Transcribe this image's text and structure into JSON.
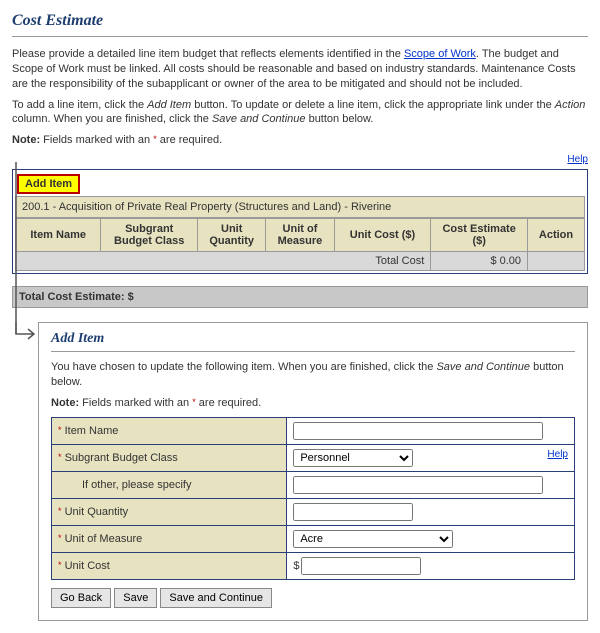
{
  "title": "Cost Estimate",
  "intro": {
    "p1a": "Please provide a detailed line item budget that reflects elements identified in the ",
    "scope_link": "Scope of Work",
    "p1b": ". The budget and Scope of Work must be linked. All costs should be reasonable and based on industry standards. Maintenance Costs are the responsibility of the subapplicant or owner of the area to be mitigated and should not be included.",
    "p2a": "To add a line item, click the ",
    "p2b": " button. To update or delete a line item, click the appropriate link under the ",
    "p2c": " column. When you are finished, click the ",
    "p2d": " button below.",
    "add_item_em": "Add Item",
    "action_em": "Action",
    "save_cont_em": "Save and Continue",
    "note_label": "Note:",
    "note_text": "  Fields marked with an ",
    "note_text2": " are required.",
    "asterisk": "*"
  },
  "help": "Help",
  "add_item_btn": "Add Item",
  "section_header": "200.1 - Acquisition of Private Real Property (Structures and Land) - Riverine",
  "columns": {
    "item_name": "Item Name",
    "budget_class": "Subgrant Budget Class",
    "unit_qty": "Unit Quantity",
    "unit_measure": "Unit of Measure",
    "unit_cost": "Unit Cost ($)",
    "cost_est": "Cost Estimate ($)",
    "action": "Action"
  },
  "totals": {
    "row_label": "Total Cost",
    "row_value": "$ 0.00",
    "grand": "Total Cost Estimate: $"
  },
  "panel": {
    "title": "Add Item",
    "intro_a": "You have chosen to update the following item. When you are finished, click the ",
    "intro_em": "Save and Continue",
    "intro_b": " button below.",
    "note_label": "Note:",
    "note_a": " Fields marked with an ",
    "note_b": " are required.",
    "labels": {
      "item_name": "Item Name",
      "budget_class": "Subgrant Budget Class",
      "other": "If other, please specify",
      "unit_qty": "Unit Quantity",
      "unit_measure": "Unit of Measure",
      "unit_cost": "Unit Cost"
    },
    "budget_class_value": "Personnel",
    "unit_measure_value": "Acre",
    "dollar": "$",
    "help": "Help",
    "buttons": {
      "back": "Go Back",
      "save": "Save",
      "save_cont": "Save and Continue"
    }
  }
}
